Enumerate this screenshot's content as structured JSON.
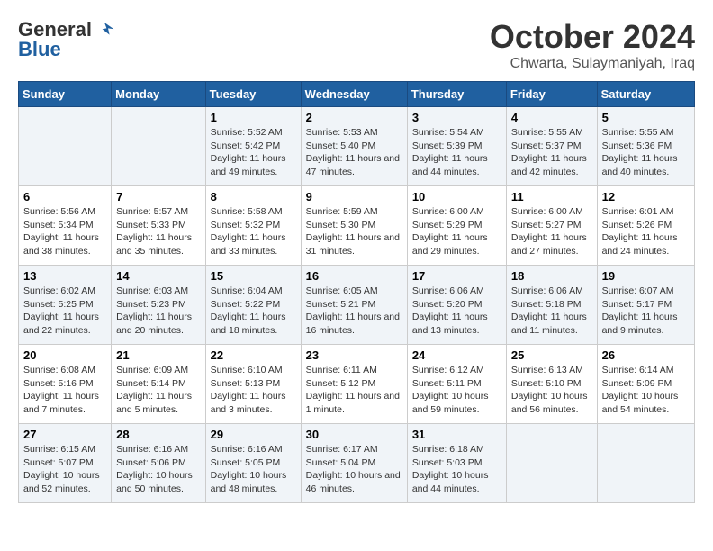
{
  "logo": {
    "line1": "General",
    "line2": "Blue"
  },
  "title": "October 2024",
  "location": "Chwarta, Sulaymaniyah, Iraq",
  "days_header": [
    "Sunday",
    "Monday",
    "Tuesday",
    "Wednesday",
    "Thursday",
    "Friday",
    "Saturday"
  ],
  "weeks": [
    [
      {
        "day": "",
        "info": ""
      },
      {
        "day": "",
        "info": ""
      },
      {
        "day": "1",
        "info": "Sunrise: 5:52 AM\nSunset: 5:42 PM\nDaylight: 11 hours and 49 minutes."
      },
      {
        "day": "2",
        "info": "Sunrise: 5:53 AM\nSunset: 5:40 PM\nDaylight: 11 hours and 47 minutes."
      },
      {
        "day": "3",
        "info": "Sunrise: 5:54 AM\nSunset: 5:39 PM\nDaylight: 11 hours and 44 minutes."
      },
      {
        "day": "4",
        "info": "Sunrise: 5:55 AM\nSunset: 5:37 PM\nDaylight: 11 hours and 42 minutes."
      },
      {
        "day": "5",
        "info": "Sunrise: 5:55 AM\nSunset: 5:36 PM\nDaylight: 11 hours and 40 minutes."
      }
    ],
    [
      {
        "day": "6",
        "info": "Sunrise: 5:56 AM\nSunset: 5:34 PM\nDaylight: 11 hours and 38 minutes."
      },
      {
        "day": "7",
        "info": "Sunrise: 5:57 AM\nSunset: 5:33 PM\nDaylight: 11 hours and 35 minutes."
      },
      {
        "day": "8",
        "info": "Sunrise: 5:58 AM\nSunset: 5:32 PM\nDaylight: 11 hours and 33 minutes."
      },
      {
        "day": "9",
        "info": "Sunrise: 5:59 AM\nSunset: 5:30 PM\nDaylight: 11 hours and 31 minutes."
      },
      {
        "day": "10",
        "info": "Sunrise: 6:00 AM\nSunset: 5:29 PM\nDaylight: 11 hours and 29 minutes."
      },
      {
        "day": "11",
        "info": "Sunrise: 6:00 AM\nSunset: 5:27 PM\nDaylight: 11 hours and 27 minutes."
      },
      {
        "day": "12",
        "info": "Sunrise: 6:01 AM\nSunset: 5:26 PM\nDaylight: 11 hours and 24 minutes."
      }
    ],
    [
      {
        "day": "13",
        "info": "Sunrise: 6:02 AM\nSunset: 5:25 PM\nDaylight: 11 hours and 22 minutes."
      },
      {
        "day": "14",
        "info": "Sunrise: 6:03 AM\nSunset: 5:23 PM\nDaylight: 11 hours and 20 minutes."
      },
      {
        "day": "15",
        "info": "Sunrise: 6:04 AM\nSunset: 5:22 PM\nDaylight: 11 hours and 18 minutes."
      },
      {
        "day": "16",
        "info": "Sunrise: 6:05 AM\nSunset: 5:21 PM\nDaylight: 11 hours and 16 minutes."
      },
      {
        "day": "17",
        "info": "Sunrise: 6:06 AM\nSunset: 5:20 PM\nDaylight: 11 hours and 13 minutes."
      },
      {
        "day": "18",
        "info": "Sunrise: 6:06 AM\nSunset: 5:18 PM\nDaylight: 11 hours and 11 minutes."
      },
      {
        "day": "19",
        "info": "Sunrise: 6:07 AM\nSunset: 5:17 PM\nDaylight: 11 hours and 9 minutes."
      }
    ],
    [
      {
        "day": "20",
        "info": "Sunrise: 6:08 AM\nSunset: 5:16 PM\nDaylight: 11 hours and 7 minutes."
      },
      {
        "day": "21",
        "info": "Sunrise: 6:09 AM\nSunset: 5:14 PM\nDaylight: 11 hours and 5 minutes."
      },
      {
        "day": "22",
        "info": "Sunrise: 6:10 AM\nSunset: 5:13 PM\nDaylight: 11 hours and 3 minutes."
      },
      {
        "day": "23",
        "info": "Sunrise: 6:11 AM\nSunset: 5:12 PM\nDaylight: 11 hours and 1 minute."
      },
      {
        "day": "24",
        "info": "Sunrise: 6:12 AM\nSunset: 5:11 PM\nDaylight: 10 hours and 59 minutes."
      },
      {
        "day": "25",
        "info": "Sunrise: 6:13 AM\nSunset: 5:10 PM\nDaylight: 10 hours and 56 minutes."
      },
      {
        "day": "26",
        "info": "Sunrise: 6:14 AM\nSunset: 5:09 PM\nDaylight: 10 hours and 54 minutes."
      }
    ],
    [
      {
        "day": "27",
        "info": "Sunrise: 6:15 AM\nSunset: 5:07 PM\nDaylight: 10 hours and 52 minutes."
      },
      {
        "day": "28",
        "info": "Sunrise: 6:16 AM\nSunset: 5:06 PM\nDaylight: 10 hours and 50 minutes."
      },
      {
        "day": "29",
        "info": "Sunrise: 6:16 AM\nSunset: 5:05 PM\nDaylight: 10 hours and 48 minutes."
      },
      {
        "day": "30",
        "info": "Sunrise: 6:17 AM\nSunset: 5:04 PM\nDaylight: 10 hours and 46 minutes."
      },
      {
        "day": "31",
        "info": "Sunrise: 6:18 AM\nSunset: 5:03 PM\nDaylight: 10 hours and 44 minutes."
      },
      {
        "day": "",
        "info": ""
      },
      {
        "day": "",
        "info": ""
      }
    ]
  ]
}
